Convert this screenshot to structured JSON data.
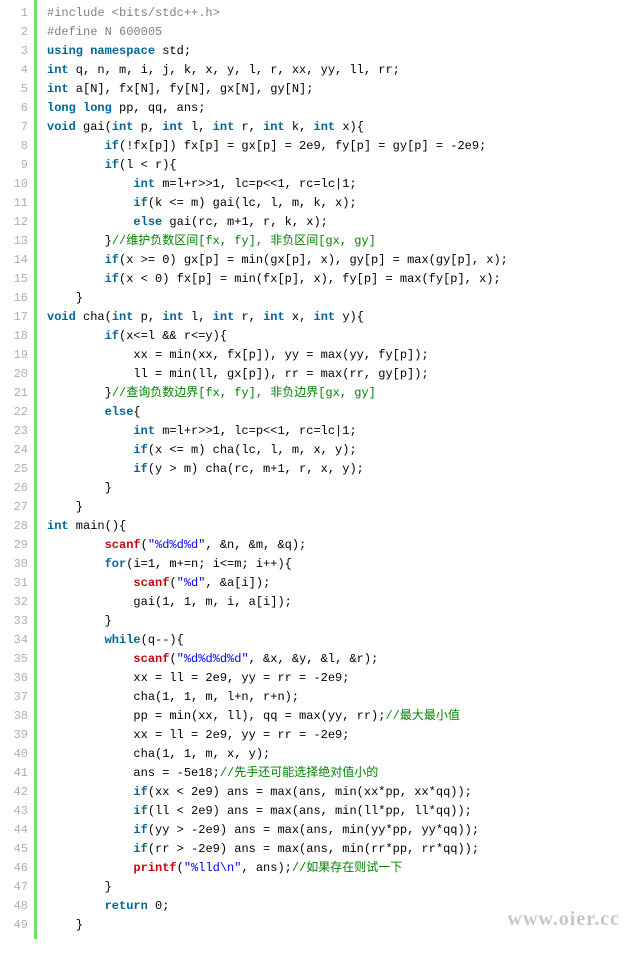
{
  "watermark": "www.oier.cc",
  "lines": [
    [
      [
        "pp",
        "#include <bits/stdc++.h>"
      ]
    ],
    [
      [
        "pp",
        "#define N 600005"
      ]
    ],
    [
      [
        "kw",
        "using"
      ],
      [
        "fn",
        " "
      ],
      [
        "kw",
        "namespace"
      ],
      [
        "fn",
        " std;"
      ]
    ],
    [
      [
        "ty",
        "int"
      ],
      [
        "fn",
        " q, n, m, i, j, k, x, y, l, r, xx, yy, ll, rr;"
      ]
    ],
    [
      [
        "ty",
        "int"
      ],
      [
        "fn",
        " a[N], fx[N], fy[N], gx[N], gy[N];"
      ]
    ],
    [
      [
        "ty",
        "long"
      ],
      [
        "fn",
        " "
      ],
      [
        "ty",
        "long"
      ],
      [
        "fn",
        " pp, qq, ans;"
      ]
    ],
    [
      [
        "ty",
        "void"
      ],
      [
        "fn",
        " gai("
      ],
      [
        "ty",
        "int"
      ],
      [
        "fn",
        " p, "
      ],
      [
        "ty",
        "int"
      ],
      [
        "fn",
        " l, "
      ],
      [
        "ty",
        "int"
      ],
      [
        "fn",
        " r, "
      ],
      [
        "ty",
        "int"
      ],
      [
        "fn",
        " k, "
      ],
      [
        "ty",
        "int"
      ],
      [
        "fn",
        " x){"
      ]
    ],
    [
      [
        "fn",
        "        "
      ],
      [
        "kw",
        "if"
      ],
      [
        "fn",
        "(!fx[p]) fx[p] = gx[p] = 2e9, fy[p] = gy[p] = -2e9;"
      ]
    ],
    [
      [
        "fn",
        "        "
      ],
      [
        "kw",
        "if"
      ],
      [
        "fn",
        "(l < r){"
      ]
    ],
    [
      [
        "fn",
        "            "
      ],
      [
        "ty",
        "int"
      ],
      [
        "fn",
        " m=l+r>>1, lc=p<<1, rc=lc|1;"
      ]
    ],
    [
      [
        "fn",
        "            "
      ],
      [
        "kw",
        "if"
      ],
      [
        "fn",
        "(k <= m) gai(lc, l, m, k, x);"
      ]
    ],
    [
      [
        "fn",
        "            "
      ],
      [
        "kw",
        "else"
      ],
      [
        "fn",
        " gai(rc, m+1, r, k, x);"
      ]
    ],
    [
      [
        "fn",
        "        }"
      ],
      [
        "cm",
        "//维护负数区间[fx, fy], 非负区间[gx, gy]"
      ]
    ],
    [
      [
        "fn",
        "        "
      ],
      [
        "kw",
        "if"
      ],
      [
        "fn",
        "(x >= 0) gx[p] = min(gx[p], x), gy[p] = max(gy[p], x);"
      ]
    ],
    [
      [
        "fn",
        "        "
      ],
      [
        "kw",
        "if"
      ],
      [
        "fn",
        "(x < 0) fx[p] = min(fx[p], x), fy[p] = max(fy[p], x);"
      ]
    ],
    [
      [
        "fn",
        "    }"
      ]
    ],
    [
      [
        "ty",
        "void"
      ],
      [
        "fn",
        " cha("
      ],
      [
        "ty",
        "int"
      ],
      [
        "fn",
        " p, "
      ],
      [
        "ty",
        "int"
      ],
      [
        "fn",
        " l, "
      ],
      [
        "ty",
        "int"
      ],
      [
        "fn",
        " r, "
      ],
      [
        "ty",
        "int"
      ],
      [
        "fn",
        " x, "
      ],
      [
        "ty",
        "int"
      ],
      [
        "fn",
        " y){"
      ]
    ],
    [
      [
        "fn",
        "        "
      ],
      [
        "kw",
        "if"
      ],
      [
        "fn",
        "(x<=l && r<=y){"
      ]
    ],
    [
      [
        "fn",
        "            xx = min(xx, fx[p]), yy = max(yy, fy[p]);"
      ]
    ],
    [
      [
        "fn",
        "            ll = min(ll, gx[p]), rr = max(rr, gy[p]);"
      ]
    ],
    [
      [
        "fn",
        "        }"
      ],
      [
        "cm",
        "//查询负数边界[fx, fy], 非负边界[gx, gy]"
      ]
    ],
    [
      [
        "fn",
        "        "
      ],
      [
        "kw",
        "else"
      ],
      [
        "fn",
        "{"
      ]
    ],
    [
      [
        "fn",
        "            "
      ],
      [
        "ty",
        "int"
      ],
      [
        "fn",
        " m=l+r>>1, lc=p<<1, rc=lc|1;"
      ]
    ],
    [
      [
        "fn",
        "            "
      ],
      [
        "kw",
        "if"
      ],
      [
        "fn",
        "(x <= m) cha(lc, l, m, x, y);"
      ]
    ],
    [
      [
        "fn",
        "            "
      ],
      [
        "kw",
        "if"
      ],
      [
        "fn",
        "(y > m) cha(rc, m+1, r, x, y);"
      ]
    ],
    [
      [
        "fn",
        "        }"
      ]
    ],
    [
      [
        "fn",
        "    }"
      ]
    ],
    [
      [
        "ty",
        "int"
      ],
      [
        "fn",
        " main(){"
      ]
    ],
    [
      [
        "fn",
        "        "
      ],
      [
        "io",
        "scanf"
      ],
      [
        "fn",
        "("
      ],
      [
        "str",
        "\"%d%d%d\""
      ],
      [
        "fn",
        ", &n, &m, &q);"
      ]
    ],
    [
      [
        "fn",
        "        "
      ],
      [
        "kw",
        "for"
      ],
      [
        "fn",
        "(i=1, m+=n; i<=m; i++){"
      ]
    ],
    [
      [
        "fn",
        "            "
      ],
      [
        "io",
        "scanf"
      ],
      [
        "fn",
        "("
      ],
      [
        "str",
        "\"%d\""
      ],
      [
        "fn",
        ", &a[i]);"
      ]
    ],
    [
      [
        "fn",
        "            gai(1, 1, m, i, a[i]);"
      ]
    ],
    [
      [
        "fn",
        "        }"
      ]
    ],
    [
      [
        "fn",
        "        "
      ],
      [
        "kw",
        "while"
      ],
      [
        "fn",
        "(q--){"
      ]
    ],
    [
      [
        "fn",
        "            "
      ],
      [
        "io",
        "scanf"
      ],
      [
        "fn",
        "("
      ],
      [
        "str",
        "\"%d%d%d%d\""
      ],
      [
        "fn",
        ", &x, &y, &l, &r);"
      ]
    ],
    [
      [
        "fn",
        "            xx = ll = 2e9, yy = rr = -2e9;"
      ]
    ],
    [
      [
        "fn",
        "            cha(1, 1, m, l+n, r+n);"
      ]
    ],
    [
      [
        "fn",
        "            pp = min(xx, ll), qq = max(yy, rr);"
      ],
      [
        "cm",
        "//最大最小值"
      ]
    ],
    [
      [
        "fn",
        "            xx = ll = 2e9, yy = rr = -2e9;"
      ]
    ],
    [
      [
        "fn",
        "            cha(1, 1, m, x, y);"
      ]
    ],
    [
      [
        "fn",
        "            ans = -5e18;"
      ],
      [
        "cm",
        "//先手还可能选择绝对值小的"
      ]
    ],
    [
      [
        "fn",
        "            "
      ],
      [
        "kw",
        "if"
      ],
      [
        "fn",
        "(xx < 2e9) ans = max(ans, min(xx*pp, xx*qq));"
      ]
    ],
    [
      [
        "fn",
        "            "
      ],
      [
        "kw",
        "if"
      ],
      [
        "fn",
        "(ll < 2e9) ans = max(ans, min(ll*pp, ll*qq));"
      ]
    ],
    [
      [
        "fn",
        "            "
      ],
      [
        "kw",
        "if"
      ],
      [
        "fn",
        "(yy > -2e9) ans = max(ans, min(yy*pp, yy*qq));"
      ]
    ],
    [
      [
        "fn",
        "            "
      ],
      [
        "kw",
        "if"
      ],
      [
        "fn",
        "(rr > -2e9) ans = max(ans, min(rr*pp, rr*qq));"
      ]
    ],
    [
      [
        "fn",
        "            "
      ],
      [
        "io",
        "printf"
      ],
      [
        "fn",
        "("
      ],
      [
        "str",
        "\"%lld\\n\""
      ],
      [
        "fn",
        ", ans);"
      ],
      [
        "cm",
        "//如果存在则试一下"
      ]
    ],
    [
      [
        "fn",
        "        }"
      ]
    ],
    [
      [
        "fn",
        "        "
      ],
      [
        "kw",
        "return"
      ],
      [
        "fn",
        " 0;"
      ]
    ],
    [
      [
        "fn",
        "    }"
      ]
    ]
  ]
}
